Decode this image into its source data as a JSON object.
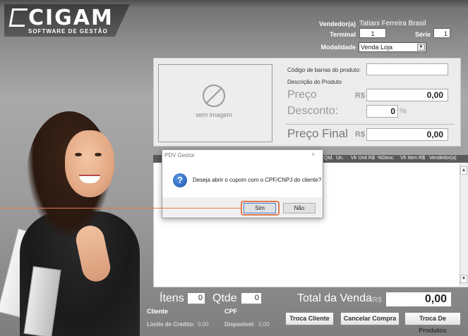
{
  "brand": {
    "name": "CIGAM",
    "tagline": "SOFTWARE DE GESTÃO"
  },
  "header": {
    "vendedor_label": "Vendedor(a)",
    "vendedor_value": "Tatiani Ferreira Brasil",
    "terminal_label": "Terminal",
    "terminal_value": "1",
    "serie_label": "Série",
    "serie_value": "1",
    "modalidade_label": "Modalidade",
    "modalidade_value": "Venda Loja"
  },
  "product": {
    "no_image_text": "sem imagem",
    "barcode_label": "Código de barras do produto:",
    "barcode_value": "",
    "description_label": "Descrição do Produto",
    "preco_label": "Preço",
    "preco_currency": "R$",
    "preco_value": "0,00",
    "desconto_label": "Desconto:",
    "desconto_value": "0",
    "desconto_unit": "%",
    "preco_final_label": "Preço Final",
    "preco_final_currency": "R$",
    "preco_final_value": "0,00"
  },
  "list": {
    "columns": [
      "Qtd.",
      "Un.",
      "Vlr Unit R$",
      "%Desc.",
      "Vlr Item R$",
      "Vendedor(a)"
    ]
  },
  "totals": {
    "itens_label": "Ítens",
    "itens_value": "0",
    "qtde_label": "Qtde",
    "qtde_value": "0",
    "total_label": "Total da Venda",
    "total_currency": "R$",
    "total_value": "0,00",
    "cliente_label": "Cliente",
    "cpf_label": "CPF",
    "limite_label": "Limite de Crédito:",
    "limite_value": "0,00",
    "disponivel_label": "Disponível:",
    "disponivel_value": "0,00"
  },
  "actions": {
    "troca_cliente": "Troca Cliente",
    "cancelar_compra": "Cancelar Compra",
    "troca_produtos": "Troca De Produtos"
  },
  "dialog": {
    "title": "PDV Gestor",
    "close": "×",
    "icon": "question-icon",
    "message": "Deseja abrir o cupom com o CPF/CNPJ do cliente?",
    "yes": "Sim",
    "no": "Não"
  },
  "colors": {
    "highlight": "#e07a4f",
    "header_bg": "#5a5a5a"
  }
}
